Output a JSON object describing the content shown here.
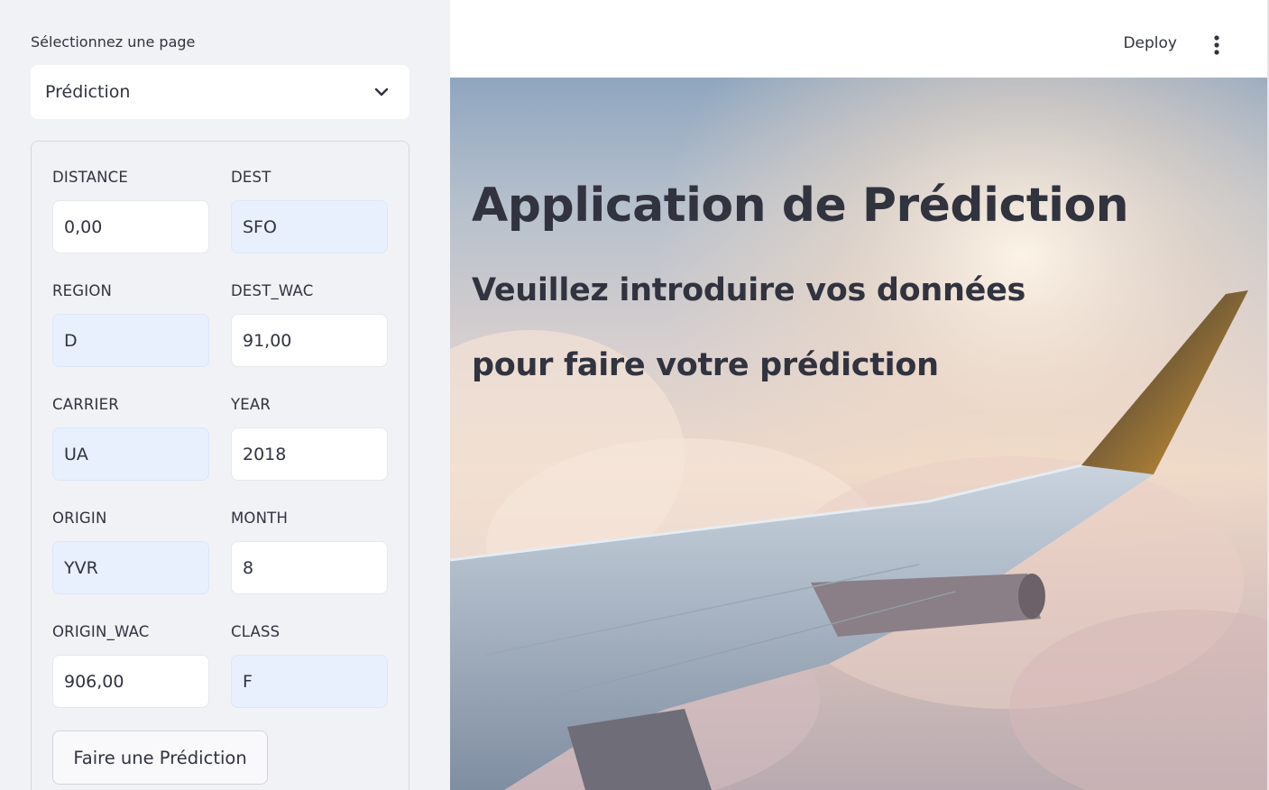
{
  "sidebar": {
    "page_label": "Sélectionnez une page",
    "page_select_value": "Prédiction",
    "fields": {
      "distance": {
        "label": "DISTANCE",
        "value": "0,00"
      },
      "dest": {
        "label": "DEST",
        "value": "SFO"
      },
      "region": {
        "label": "REGION",
        "value": "D"
      },
      "dest_wac": {
        "label": "DEST_WAC",
        "value": "91,00"
      },
      "carrier": {
        "label": "CARRIER",
        "value": "UA"
      },
      "year": {
        "label": "YEAR",
        "value": "2018"
      },
      "origin": {
        "label": "ORIGIN",
        "value": "YVR"
      },
      "month": {
        "label": "MONTH",
        "value": "8"
      },
      "origin_wac": {
        "label": "ORIGIN_WAC",
        "value": "906,00"
      },
      "class": {
        "label": "CLASS",
        "value": "F"
      }
    },
    "predict_button": "Faire une Prédiction"
  },
  "header": {
    "deploy_label": "Deploy",
    "menu_icon": "kebab-menu-icon"
  },
  "main": {
    "title": "Application de Prédiction",
    "subtitle_line1": "Veuillez introduire vos données",
    "subtitle_line2": "pour faire votre prédiction",
    "background_image": "airplane-wing-over-clouds"
  },
  "colors": {
    "sidebar_bg": "#f0f2f6",
    "text": "#31333f",
    "input_tinted": "#e8f0fe"
  }
}
